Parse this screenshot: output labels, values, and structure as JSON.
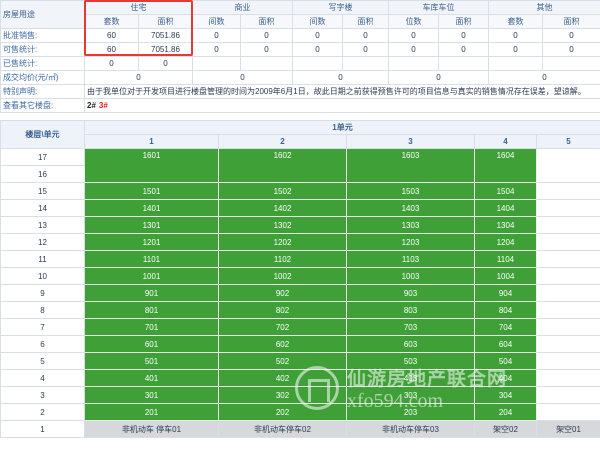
{
  "summary": {
    "corner": "房屋用途",
    "categories": [
      "住宅",
      "商业",
      "写字楼",
      "车库车位",
      "其他"
    ],
    "sub": {
      "zz": [
        "套数",
        "面积"
      ],
      "sy": [
        "间数",
        "面积"
      ],
      "xz": [
        "间数",
        "面积"
      ],
      "ck": [
        "位数",
        "面积"
      ],
      "qt": [
        "套数",
        "面积"
      ]
    },
    "rows": [
      {
        "label": "批准销售:",
        "values": [
          "60",
          "7051.86",
          "0",
          "0",
          "0",
          "0",
          "0",
          "0",
          "0",
          "0"
        ]
      },
      {
        "label": "可售统计:",
        "values": [
          "60",
          "7051.86",
          "0",
          "0",
          "0",
          "0",
          "0",
          "0",
          "0",
          "0"
        ]
      },
      {
        "label": "已售统计:",
        "values": [
          "0",
          "0",
          "",
          "",
          "",
          "",
          "",
          "",
          "",
          ""
        ]
      }
    ],
    "avg": {
      "label": "成交均价(元/㎡)",
      "values": [
        "0",
        "0",
        "0",
        "0",
        "0"
      ]
    },
    "notice": {
      "label": "特别声明:",
      "text": "由于我单位对于开发项目进行楼盘管理的时间为2009年6月1日，故此日期之前获得预售许可的项目信息与真实的销售情况存在误差，望谅解。"
    },
    "other": {
      "label": "查看其它楼盘:",
      "b1": "2#",
      "b2": "3#"
    }
  },
  "floors": {
    "header_floor": "楼层\\单元",
    "unit": "1单元",
    "cols": [
      "1",
      "2",
      "3",
      "4",
      "5"
    ],
    "rows": [
      {
        "floor": "17",
        "rooms": [
          "1601",
          "1602",
          "1603",
          "1604"
        ]
      },
      {
        "floor": "16",
        "rooms": []
      },
      {
        "floor": "15",
        "rooms": [
          "1501",
          "1502",
          "1503",
          "1504"
        ]
      },
      {
        "floor": "14",
        "rooms": [
          "1401",
          "1402",
          "1403",
          "1404"
        ]
      },
      {
        "floor": "13",
        "rooms": [
          "1301",
          "1302",
          "1303",
          "1304"
        ]
      },
      {
        "floor": "12",
        "rooms": [
          "1201",
          "1202",
          "1203",
          "1204"
        ]
      },
      {
        "floor": "11",
        "rooms": [
          "1101",
          "1102",
          "1103",
          "1104"
        ]
      },
      {
        "floor": "10",
        "rooms": [
          "1001",
          "1002",
          "1003",
          "1004"
        ]
      },
      {
        "floor": "9",
        "rooms": [
          "901",
          "902",
          "903",
          "904"
        ]
      },
      {
        "floor": "8",
        "rooms": [
          "801",
          "802",
          "803",
          "804"
        ]
      },
      {
        "floor": "7",
        "rooms": [
          "701",
          "702",
          "703",
          "704"
        ]
      },
      {
        "floor": "6",
        "rooms": [
          "601",
          "602",
          "603",
          "604"
        ]
      },
      {
        "floor": "5",
        "rooms": [
          "501",
          "502",
          "503",
          "504"
        ]
      },
      {
        "floor": "4",
        "rooms": [
          "401",
          "402",
          "403",
          "404"
        ]
      },
      {
        "floor": "3",
        "rooms": [
          "301",
          "302",
          "303",
          "304"
        ]
      },
      {
        "floor": "2",
        "rooms": [
          "201",
          "202",
          "203",
          "204"
        ]
      }
    ],
    "ground": {
      "floor": "1",
      "rooms": [
        "非机动车 停车01",
        "非机动车停车02",
        "非机动车停车03",
        "架空02",
        "架空01"
      ]
    }
  },
  "watermark": {
    "line1": "仙游房地产联合网",
    "line2": "xfo594.com"
  },
  "colors": {
    "sold_green": "#3fa037",
    "ground_gray": "#d6d8db",
    "highlight_red": "#e53935"
  }
}
